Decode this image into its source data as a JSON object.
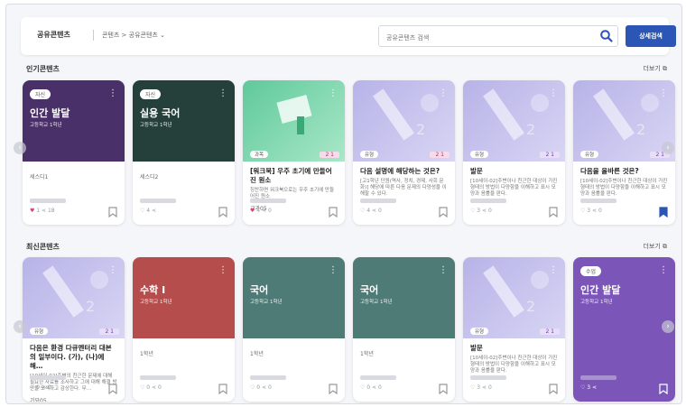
{
  "header": {
    "title": "공유콘텐츠",
    "breadcrumb": "콘텐츠 > 공유콘텐츠 ⌄",
    "search_placeholder": "공유콘텐츠 검색",
    "detail_search_label": "상세검색"
  },
  "popular": {
    "title": "인기콘텐츠",
    "more": "더보기",
    "cards": [
      {
        "tag": "자신",
        "big": "인간 발달",
        "sub": "고등학교 1학년",
        "desc_title": "",
        "desc": "",
        "small": "세스디1",
        "likes": "1",
        "shares": "18",
        "liked": true,
        "bookmarked": false
      },
      {
        "tag": "자신",
        "big": "실용 국어",
        "sub": "고등학교 1학년",
        "desc_title": "",
        "desc": "",
        "small": "세스디2",
        "likes": "4",
        "shares": "",
        "liked": false,
        "bookmarked": false
      },
      {
        "tag": "과목",
        "big": "",
        "sub": "",
        "grade": "2 1",
        "desc_title": "[워크북] 우주 초기에 만들어진 원소",
        "desc": "칭찬하면 워크북으로는 우주 초기에 만들어진 원소",
        "small": "교과05",
        "likes": "4",
        "shares": "0",
        "liked": true,
        "bookmarked": false
      },
      {
        "tag": "유형",
        "big": "",
        "sub": "",
        "grade": "2 1",
        "desc_title": "다음 설명에 해당하는 것은?",
        "desc": "[고1학년 단원(역사, 정치, 경제, 사회 문화)] 해당에 따른 다음 문제의 다양성을 이해할 수 있다.",
        "small": "",
        "likes": "4",
        "shares": "0",
        "liked": false,
        "bookmarked": false
      },
      {
        "tag": "유형",
        "big": "",
        "sub": "",
        "grade": "2 1",
        "desc_title": "발문",
        "desc": "[10세이-02]주변이나 친근한 대상이 가진 형태의 방법이 다양함을 이해하고 표시 모양과 음률을 판다.",
        "small": "",
        "likes": "3",
        "shares": "0",
        "liked": false,
        "bookmarked": false
      },
      {
        "tag": "유형",
        "big": "",
        "sub": "",
        "grade": "2 1",
        "desc_title": "다음을 올바른 것은?",
        "desc": "[10세이-02]주변이나 친근한 대상이 가진 형태의 방법이 다양함을 이해하고 표시 모양과 음률을 판다.",
        "small": "",
        "likes": "3",
        "shares": "0",
        "liked": false,
        "bookmarked": true
      }
    ]
  },
  "recent": {
    "title": "최신콘텐츠",
    "more": "더보기",
    "cards": [
      {
        "tag": "유형",
        "big": "",
        "sub": "",
        "grade": "2 1",
        "desc_title": "다음은 환경 다큐멘터리 대본의 일부이다. (가), (나)에 해…",
        "desc": "[10세이-02]주변의 친근한 문제에 대해 필요한 자료를 조사하고 그에 대해 해결 방안을 모색하고 감상한다. 무…",
        "small": "기묘05",
        "likes": "0",
        "shares": "0",
        "liked": false,
        "bookmarked": false
      },
      {
        "tag": "",
        "big": "수학 I",
        "sub": "고등학교 1학년",
        "desc_title": "",
        "desc": "",
        "small": "1학년",
        "likes": "0",
        "shares": "0",
        "liked": false,
        "bookmarked": false
      },
      {
        "tag": "",
        "big": "국어",
        "sub": "고등학교 1학년",
        "desc_title": "",
        "desc": "",
        "small": "1학년",
        "likes": "0",
        "shares": "0",
        "liked": false,
        "bookmarked": false
      },
      {
        "tag": "",
        "big": "국어",
        "sub": "고등학교 1학년",
        "desc_title": "",
        "desc": "",
        "small": "1학년",
        "likes": "0",
        "shares": "0",
        "liked": false,
        "bookmarked": false
      },
      {
        "tag": "유형",
        "big": "",
        "sub": "",
        "grade": "2 1",
        "desc_title": "발문",
        "desc": "[10세이-02]주변이나 친근한 대상이 가진 형태의 방법이 다양함을 이해하고 표시 모양과 음률을 판다.",
        "small": "",
        "likes": "3",
        "shares": "0",
        "liked": false,
        "bookmarked": false
      },
      {
        "tag": "수업",
        "big": "인간 발달",
        "sub": "고등학교 1학년",
        "desc_title": "",
        "desc": "",
        "small": "",
        "likes": "3",
        "shares": "",
        "liked": false,
        "bookmarked": false
      }
    ]
  },
  "colors": {
    "purple_dark": "#4a3068",
    "green_dark": "#25403a",
    "green_light": "#5fc99a",
    "lilac": "#b7b3e8",
    "red": "#b64d4d",
    "teal": "#4f7b76",
    "violet": "#7b55b8",
    "accent": "#2b56b5",
    "heart": "#e23b7a"
  }
}
